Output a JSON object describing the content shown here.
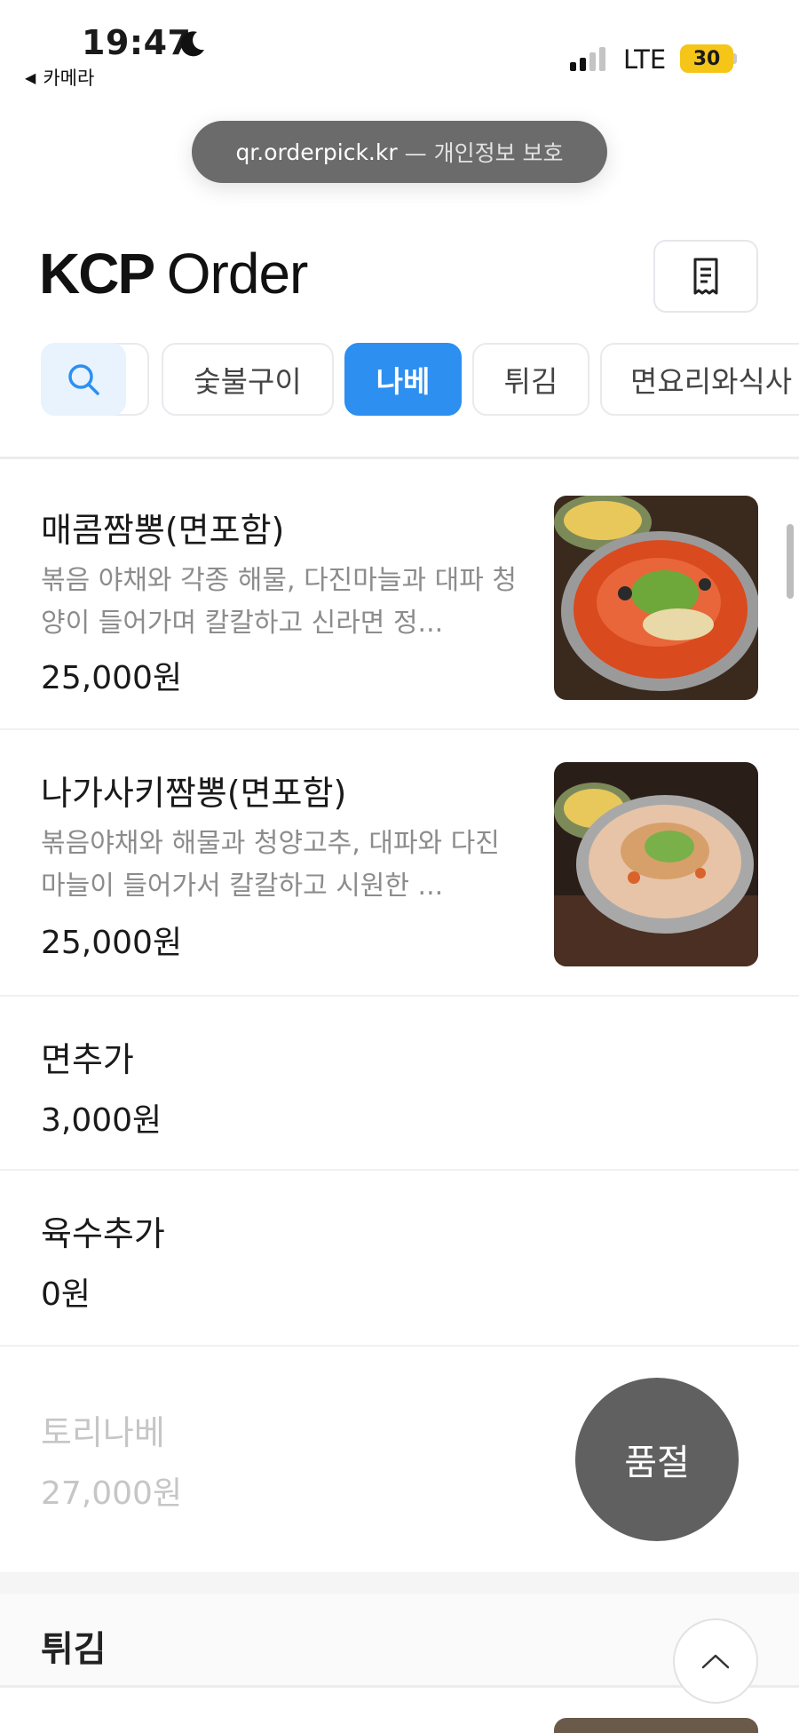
{
  "status_bar": {
    "time": "19:47",
    "back_app": "카메라",
    "network": "LTE",
    "battery": "30"
  },
  "browser": {
    "url": "qr.orderpick.kr",
    "url_suffix": "— 개인정보 보호"
  },
  "header": {
    "logo_kcp": "KCP",
    "logo_order": "Order"
  },
  "tabs": [
    {
      "label": "숯불구이",
      "active": false
    },
    {
      "label": "나베",
      "active": true
    },
    {
      "label": "튀김",
      "active": false
    },
    {
      "label": "면요리와식사",
      "active": false
    }
  ],
  "menu": [
    {
      "name": "매콤짬뽕(면포함)",
      "desc": "볶음 야채와 각종 해물, 다진마늘과 대파 청양이 들어가며 칼칼하고 신라면 정...",
      "price": "25,000원"
    },
    {
      "name": "나가사키짬뽕(면포함)",
      "desc": "볶음야채와 해물과 청양고추, 대파와 다진마늘이 들어가서 칼칼하고 시원한 ...",
      "price": "25,000원"
    },
    {
      "name": "면추가",
      "price": "3,000원"
    },
    {
      "name": "육수추가",
      "price": "0원"
    },
    {
      "name": "토리나베",
      "price": "27,000원",
      "badge": "품절"
    }
  ],
  "section": {
    "title": "튀김"
  },
  "colors": {
    "accent": "#2d8ff0",
    "search_tab_bg": "#e8f3fd",
    "soldout_badge": "#606060"
  }
}
